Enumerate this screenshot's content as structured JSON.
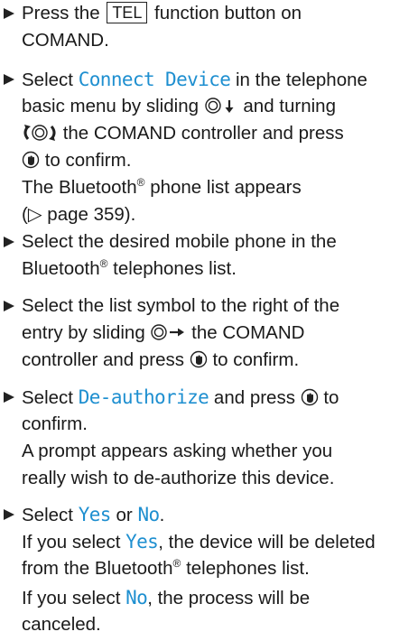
{
  "step1": {
    "pre": "Press the",
    "key": "TEL",
    "post": "function button on",
    "line2": "COMAND."
  },
  "step2": {
    "l1_pre": "Select",
    "l1_hl": "Connect Device",
    "l1_post": "in the telephone",
    "l2_pre": "basic menu by sliding",
    "l2_post": "and turning",
    "l3_post": "the COMAND controller and press",
    "l4_post": "to confirm.",
    "l5_pre": "The Bluetooth",
    "reg": "®",
    "l5_post": "phone list appears",
    "l6": "(▷ page 359)."
  },
  "step3": {
    "l1": "Select the desired mobile phone in the",
    "l2_pre": "Bluetooth",
    "reg": "®",
    "l2_post": "telephones list."
  },
  "step4": {
    "l1": "Select the list symbol to the right of the",
    "l2_pre": "entry by sliding",
    "l2_post": "the COMAND",
    "l3_pre": "controller and press",
    "l3_post": "to confirm."
  },
  "step5": {
    "l1_pre": "Select",
    "l1_hl": "De-authorize",
    "l1_mid": "and press",
    "l1_post": "to",
    "l2": "confirm.",
    "l3": "A prompt appears asking whether you",
    "l4": "really wish to de-authorize this device."
  },
  "step6": {
    "l1_pre": "Select",
    "yes": "Yes",
    "or": "or",
    "no": "No",
    "period": ".",
    "l2_pre": "If you select",
    "l2_post": ", the device will be deleted",
    "l3_pre": "from the Bluetooth",
    "reg": "®",
    "l3_post": "telephones list.",
    "l4_pre": "If you select",
    "l4_post": ", the process will be",
    "l5": "canceled."
  },
  "colors": {
    "highlight": "#1e8fd0",
    "text": "#1a1a1a"
  },
  "icons": [
    "controller-slide-down-icon",
    "controller-turn-icon",
    "controller-press-icon",
    "controller-slide-right-icon",
    "bullet-arrow-icon"
  ]
}
